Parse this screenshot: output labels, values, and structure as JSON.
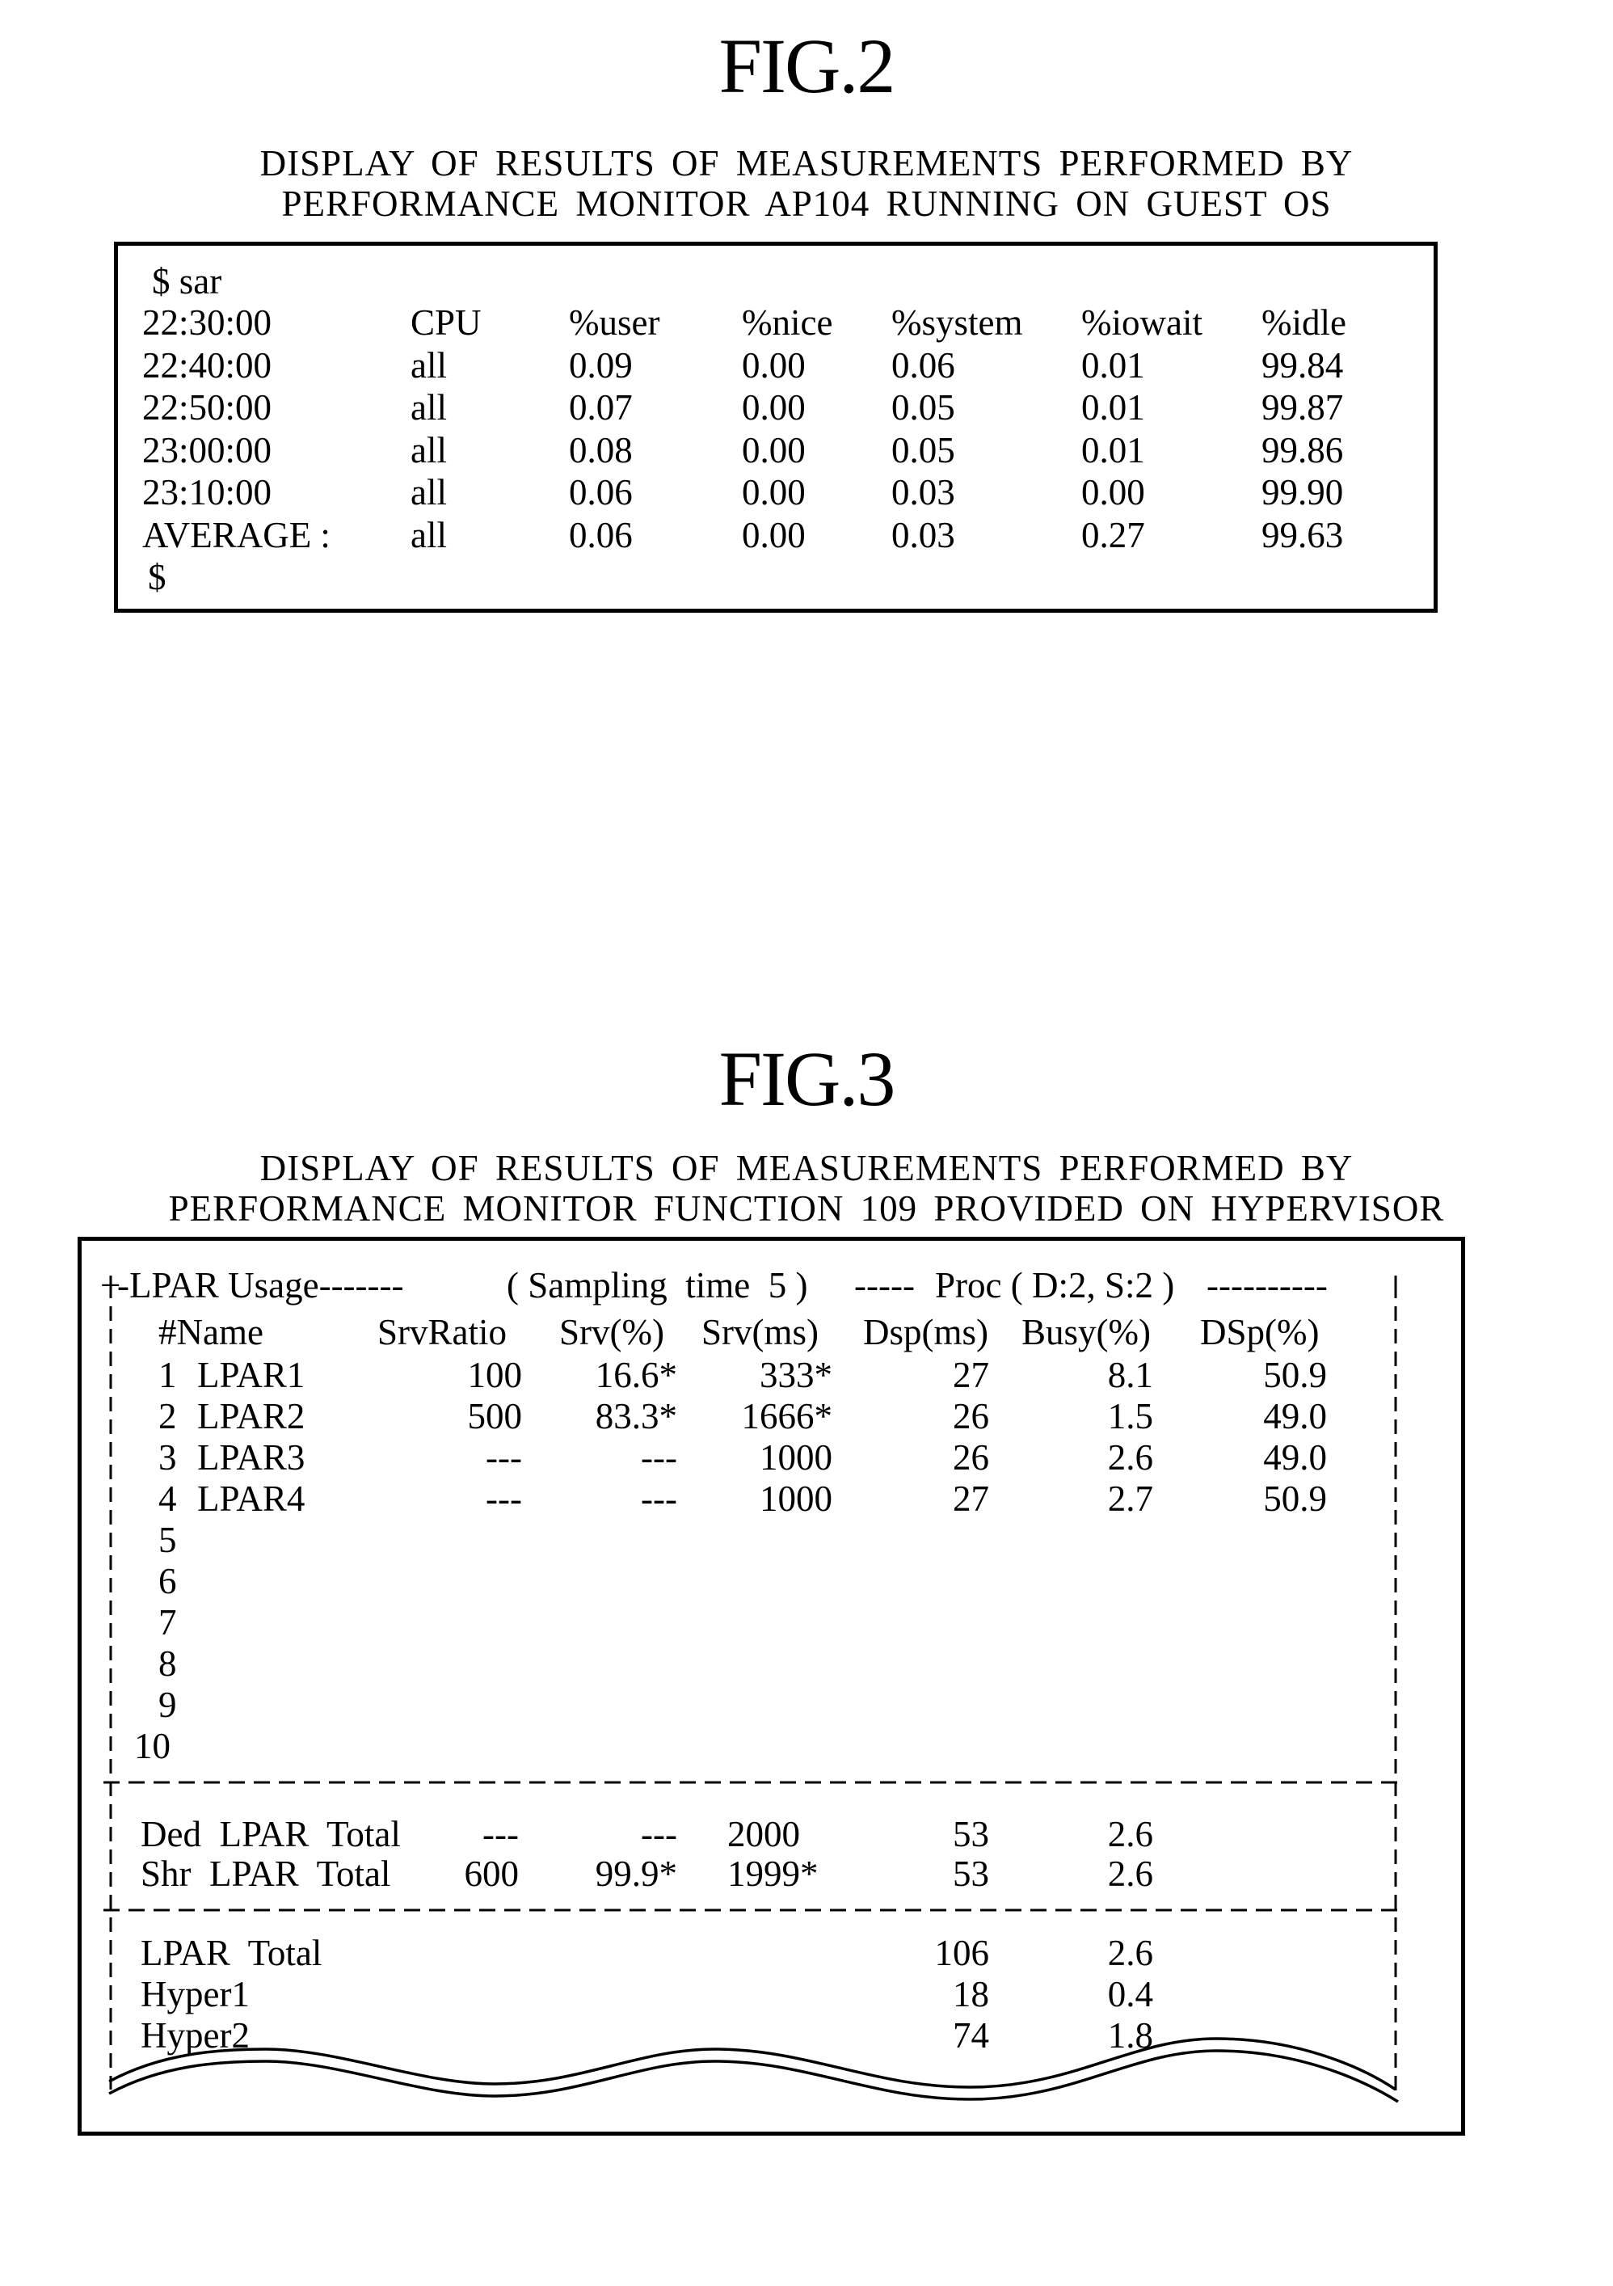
{
  "fig2": {
    "title": "FIG.2",
    "caption_line1": "DISPLAY OF RESULTS OF MEASUREMENTS PERFORMED BY",
    "caption_line2": "PERFORMANCE MONITOR AP104 RUNNING ON GUEST OS",
    "command": "$ sar",
    "header": {
      "time": "22:30:00",
      "cols": [
        "CPU",
        "%user",
        "%nice",
        "%system",
        "%iowait",
        "%idle"
      ]
    },
    "rows": [
      {
        "time": "22:40:00",
        "cpu": "all",
        "user": "0.09",
        "nice": "0.00",
        "system": "0.06",
        "iowait": "0.01",
        "idle": "99.84"
      },
      {
        "time": "22:50:00",
        "cpu": "all",
        "user": "0.07",
        "nice": "0.00",
        "system": "0.05",
        "iowait": "0.01",
        "idle": "99.87"
      },
      {
        "time": "23:00:00",
        "cpu": "all",
        "user": "0.08",
        "nice": "0.00",
        "system": "0.05",
        "iowait": "0.01",
        "idle": "99.86"
      },
      {
        "time": "23:10:00",
        "cpu": "all",
        "user": "0.06",
        "nice": "0.00",
        "system": "0.03",
        "iowait": "0.00",
        "idle": "99.90"
      },
      {
        "time": "AVERAGE :",
        "cpu": "all",
        "user": "0.06",
        "nice": "0.00",
        "system": "0.03",
        "iowait": "0.27",
        "idle": "99.63"
      }
    ],
    "prompt": "$"
  },
  "fig3": {
    "title": "FIG.3",
    "caption_line1": "DISPLAY OF RESULTS OF MEASUREMENTS PERFORMED BY",
    "caption_line2": "PERFORMANCE MONITOR FUNCTION 109 PROVIDED ON HYPERVISOR",
    "banner": {
      "corner": "+",
      "lpar_usage": "-LPAR Usage-------",
      "sampling": "( Sampling  time  5 )",
      "proc_dashes": "-----",
      "proc": "Proc ( D:2, S:2 )",
      "tail": "----------"
    },
    "columns": [
      "#Name",
      "SrvRatio",
      "Srv(%)",
      "Srv(ms)",
      "Dsp(ms)",
      "Busy(%)",
      "DSp(%)"
    ],
    "lpars": [
      {
        "num": "1",
        "name": "LPAR1",
        "srv_ratio": "100",
        "srv_pct": "16.6*",
        "srv_ms": "333*",
        "dsp_ms": "27",
        "busy_pct": "8.1",
        "dsp_pct": "50.9"
      },
      {
        "num": "2",
        "name": "LPAR2",
        "srv_ratio": "500",
        "srv_pct": "83.3*",
        "srv_ms": "1666*",
        "dsp_ms": "26",
        "busy_pct": "1.5",
        "dsp_pct": "49.0"
      },
      {
        "num": "3",
        "name": "LPAR3",
        "srv_ratio": "---",
        "srv_pct": "---",
        "srv_ms": "1000",
        "dsp_ms": "26",
        "busy_pct": "2.6",
        "dsp_pct": "49.0"
      },
      {
        "num": "4",
        "name": "LPAR4",
        "srv_ratio": "---",
        "srv_pct": "---",
        "srv_ms": "1000",
        "dsp_ms": "27",
        "busy_pct": "2.7",
        "dsp_pct": "50.9"
      },
      {
        "num": "5"
      },
      {
        "num": "6"
      },
      {
        "num": "7"
      },
      {
        "num": "8"
      },
      {
        "num": "9"
      },
      {
        "num": "10"
      }
    ],
    "subtotals": [
      {
        "label": "Ded  LPAR  Total",
        "srv_ratio": "---",
        "srv_pct": "---",
        "srv_ms": "2000",
        "dsp_ms": "53",
        "busy_pct": "2.6"
      },
      {
        "label": "Shr  LPAR  Total",
        "srv_ratio": "600",
        "srv_pct": "99.9*",
        "srv_ms": "1999*",
        "dsp_ms": "53",
        "busy_pct": "2.6"
      }
    ],
    "totals": [
      {
        "label": "LPAR  Total",
        "dsp_ms": "106",
        "busy_pct": "2.6"
      },
      {
        "label": "Hyper1",
        "dsp_ms": "18",
        "busy_pct": "0.4"
      },
      {
        "label": "Hyper2",
        "dsp_ms": "74",
        "busy_pct": "1.8"
      }
    ]
  }
}
